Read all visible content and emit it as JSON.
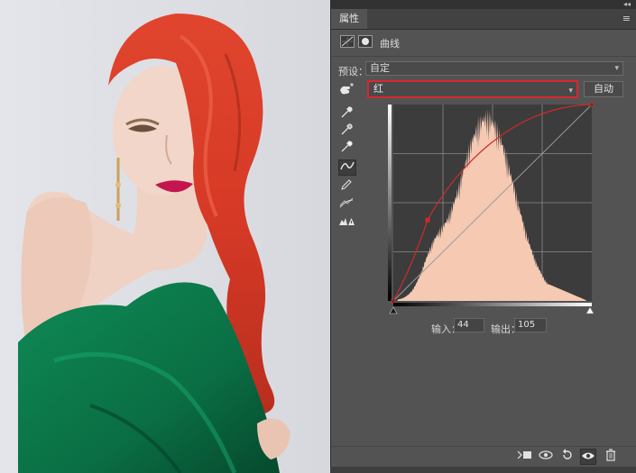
{
  "panel": {
    "tab_label": "属性",
    "collapse_glyph": "◂◂",
    "menu_glyph": "≡",
    "adjustment_title": "曲线",
    "preset_label": "预设：",
    "preset_value": "自定",
    "channel_value": "红",
    "auto_label": "自动",
    "input_label": "输入：",
    "input_value": "44",
    "output_label": "输出：",
    "output_value": "105"
  },
  "tools": [
    "hand-adjust-icon",
    "black-eyedropper-icon",
    "gray-eyedropper-icon",
    "white-eyedropper-icon",
    "curve-point-icon",
    "pencil-icon",
    "smooth-icon",
    "clipping-warning-icon"
  ],
  "bottom_icons": [
    "clip-to-layer-icon",
    "view-previous-icon",
    "reset-icon",
    "visibility-eye-icon",
    "delete-icon"
  ],
  "colors": {
    "panel_bg": "#535353",
    "highlight_border": "#d9272f",
    "histogram_fill": "#f6c9b3",
    "curve_red": "#d02a2a"
  },
  "curve": {
    "channel": "red",
    "points": [
      [
        0,
        0
      ],
      [
        44,
        105
      ],
      [
        255,
        255
      ]
    ]
  }
}
